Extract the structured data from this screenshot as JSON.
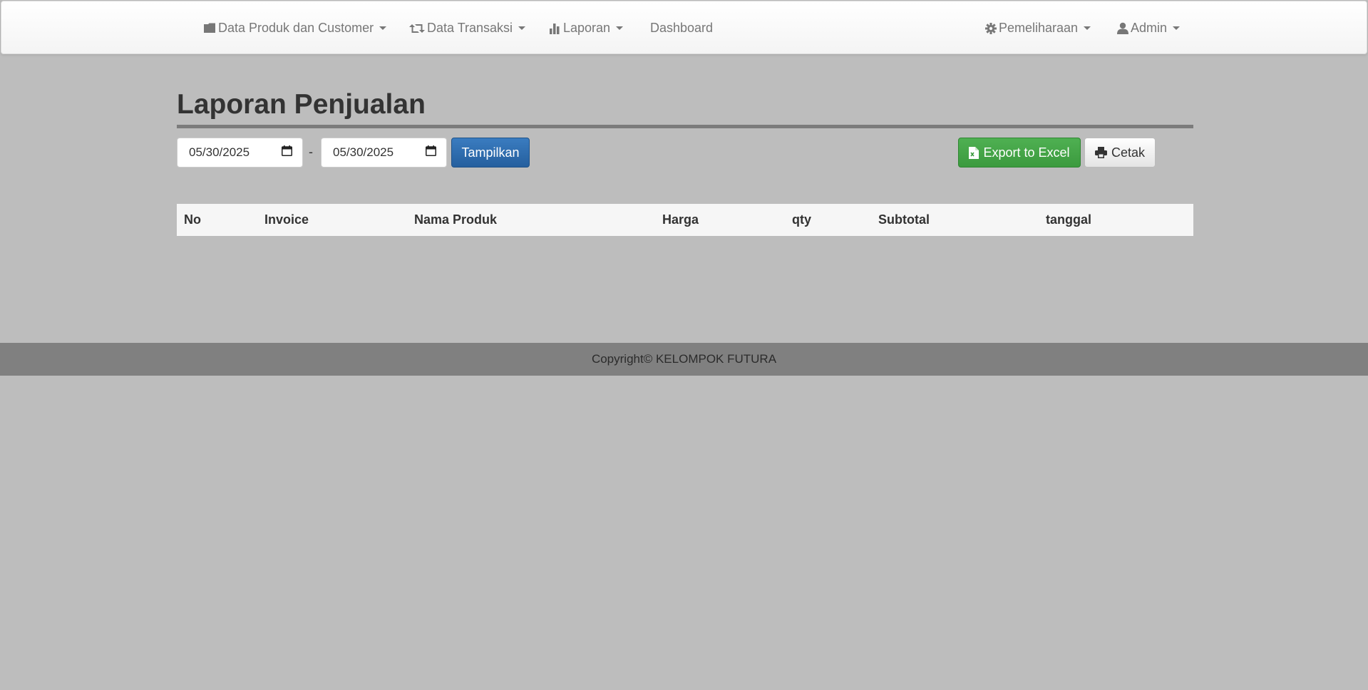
{
  "navbar": {
    "items": [
      {
        "label": "Data Produk dan Customer",
        "icon": "folder-icon",
        "dropdown": true
      },
      {
        "label": "Data Transaksi",
        "icon": "retweet-icon",
        "dropdown": true
      },
      {
        "label": "Laporan",
        "icon": "bar-chart-icon",
        "dropdown": true
      },
      {
        "label": "Dashboard",
        "dropdown": false
      }
    ],
    "right_items": [
      {
        "label": "Pemeliharaan",
        "icon": "gear-icon",
        "dropdown": true
      },
      {
        "label": "Admin",
        "icon": "user-icon",
        "dropdown": true
      }
    ]
  },
  "page": {
    "title": "Laporan Penjualan"
  },
  "filter": {
    "date_from": "05/30/2025",
    "separator": "-",
    "date_to": "05/30/2025",
    "show_button": "Tampilkan",
    "export_button": "Export to Excel",
    "print_button": "Cetak"
  },
  "table": {
    "columns": [
      "No",
      "Invoice",
      "Nama Produk",
      "Harga",
      "qty",
      "Subtotal",
      "tanggal"
    ],
    "rows": []
  },
  "footer": {
    "text": "Copyright© KELOMPOK FUTURA"
  },
  "colors": {
    "background": "#bdbdbd",
    "primary_button": "#2d6cb0",
    "success_button": "#45a548",
    "footer": "#808080",
    "title_rule": "#7c7c7c"
  }
}
